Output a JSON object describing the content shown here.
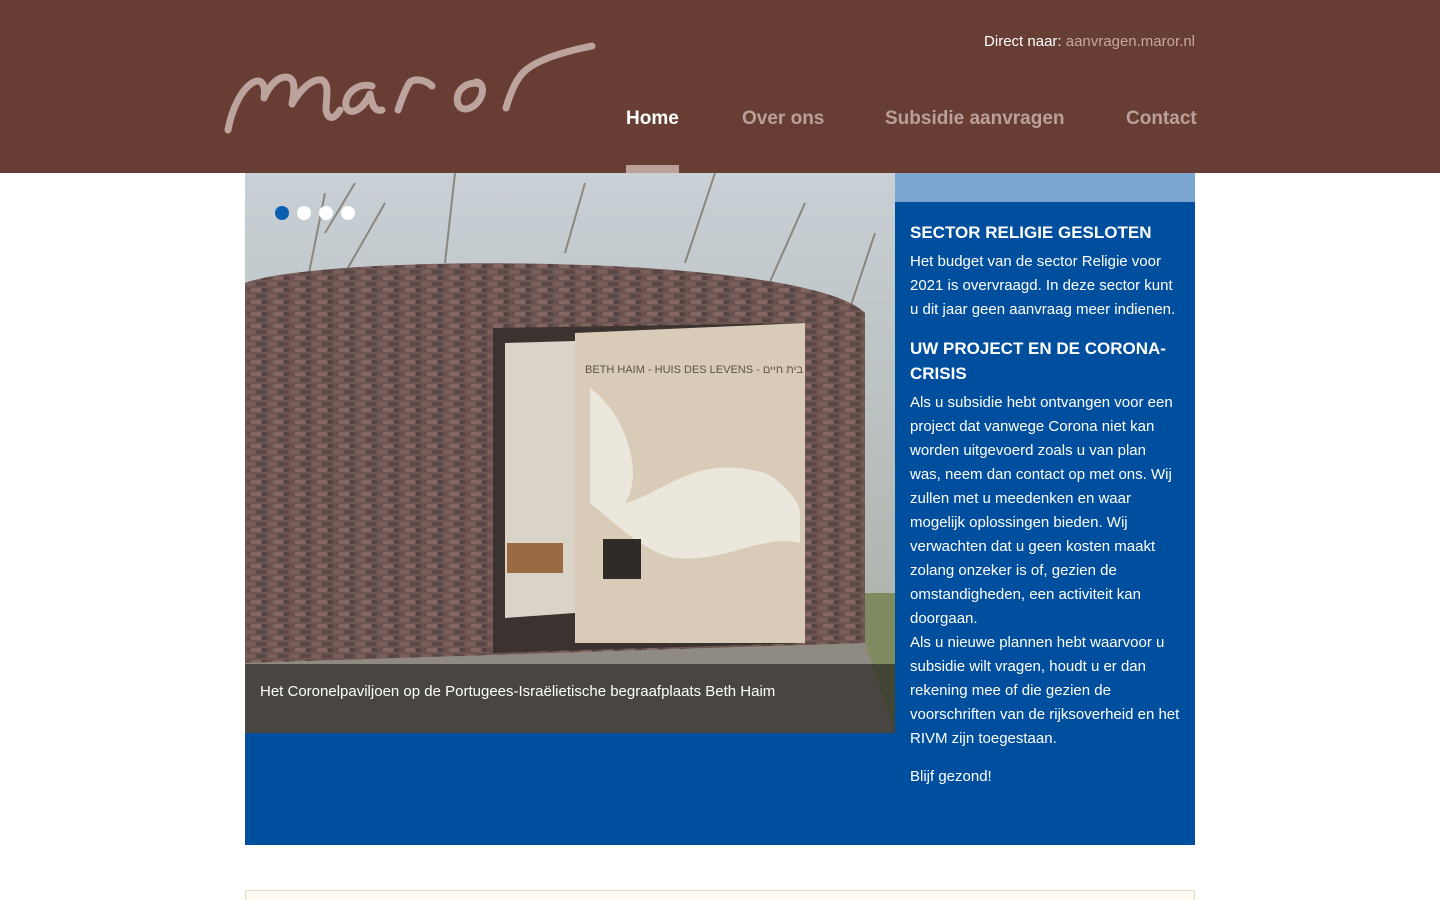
{
  "brand": {
    "logo_text": "maror"
  },
  "header": {
    "direct_label": "Direct naar:",
    "direct_link": "aanvragen.maror.nl"
  },
  "nav": {
    "items": [
      {
        "label": "Home",
        "active": true
      },
      {
        "label": "Over ons",
        "active": false
      },
      {
        "label": "Subsidie aanvragen",
        "active": false
      },
      {
        "label": "Contact",
        "active": false
      }
    ]
  },
  "slider": {
    "slide_count": 4,
    "active_slide": 1,
    "caption": "Het Coronelpaviljoen op de Portugees-Israëlietische begraafplaats Beth Haim",
    "photo_sign_text": "BETH HAIM - HUIS DES LEVENS - בית חיים"
  },
  "sidebar": {
    "block1_title": "SECTOR RELIGIE GESLOTEN",
    "block1_text": "Het budget van de sector Religie voor 2021 is overvraagd. In deze sector kunt u dit jaar geen aanvraag meer indienen.",
    "block2_title": "UW PROJECT EN DE CORONA-CRISIS",
    "block2_text1": "Als u subsidie hebt ontvangen voor een project dat vanwege Corona niet kan worden uitgevoerd zoals u van plan was, neem dan contact op met ons. Wij zullen met u meedenken en waar mogelijk oplossingen bieden. Wij verwachten dat u geen kosten maakt zolang onzeker is of, gezien de omstandigheden, een activiteit kan doorgaan.",
    "block2_text2": "Als u nieuwe plannen hebt waarvoor u subsidie wilt vragen, houdt u er dan rekening mee of die gezien de voorschriften van de rijksoverheid en het RIVM zijn toegestaan.",
    "closing": "Blijf gezond!"
  },
  "colors": {
    "header_bg": "#673d34",
    "nav_inactive": "#bba09a",
    "main_blue": "#004f9e",
    "band_light_blue": "#7ba6d2",
    "dot_active": "#0a5fb0"
  }
}
